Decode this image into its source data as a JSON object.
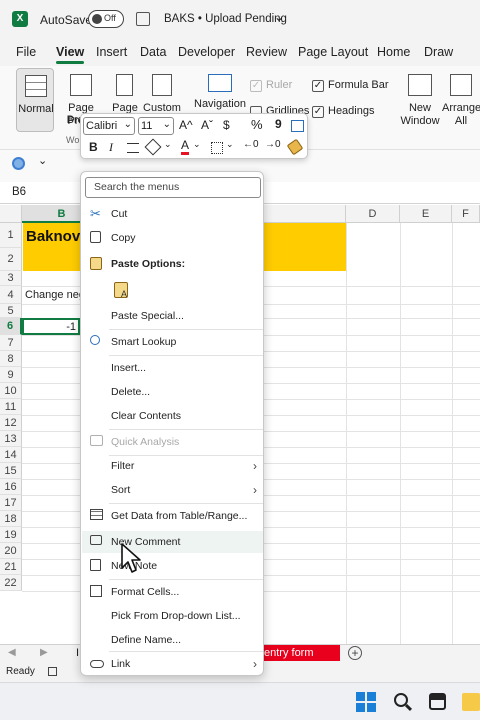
{
  "titlebar": {
    "autosave_label": "AutoSave",
    "toggle_state": "Off",
    "file_name": "BAKS • Upload Pending"
  },
  "menu": {
    "tabs": [
      "File",
      "View",
      "Insert",
      "Data",
      "Developer",
      "Review",
      "Page Layout",
      "Home",
      "Draw"
    ],
    "active": "View"
  },
  "ribbon": {
    "normal": "Normal",
    "page_break": "Page Break",
    "page_break_2": "Previ",
    "page": "Page",
    "custom": "Custom",
    "navigation": "Navigation",
    "ruler": "Ruler",
    "formula_bar": "Formula Bar",
    "gridlines": "Gridlines",
    "headings": "Headings",
    "new_window": "New Window",
    "new_window_1": "New",
    "new_window_2": "Window",
    "arrange_all_1": "Arrange",
    "arrange_all_2": "All",
    "wo_label": "Wo",
    "ruler_checked": true,
    "formula_bar_checked": true,
    "headings_checked": true
  },
  "formula": {
    "name_box": "B6"
  },
  "grid": {
    "columns": [
      "B",
      "D",
      "E",
      "F"
    ],
    "rows": [
      "1",
      "2",
      "3",
      "4",
      "5",
      "6",
      "7",
      "8",
      "9",
      "10",
      "11",
      "12",
      "13",
      "14",
      "15",
      "16",
      "17",
      "18",
      "19",
      "20",
      "21",
      "22"
    ],
    "cell_b1": "Baknov",
    "cell_b4": "Change neg",
    "cell_b6": "-1",
    "header_fill": "#ffcc00"
  },
  "mini_toolbar": {
    "font": "Calibri",
    "size": "11",
    "grow": "A^",
    "shrink": "Aˇ",
    "currency": "$",
    "percent": "%",
    "comma": "9",
    "bold": "B",
    "italic": "I",
    "font_color_letter": "A",
    "font_color": "#e81123"
  },
  "context_menu": {
    "search_placeholder": "Search the menus",
    "items": {
      "cut": "Cut",
      "copy": "Copy",
      "paste_options": "Paste Options:",
      "paste_special": "Paste Special...",
      "smart_lookup": "Smart Lookup",
      "insert": "Insert...",
      "delete": "Delete...",
      "clear_contents": "Clear Contents",
      "quick_analysis": "Quick Analysis",
      "filter": "Filter",
      "sort": "Sort",
      "get_data": "Get Data from Table/Range...",
      "new_comment": "New Comment",
      "new_note": "New Note",
      "format_cells": "Format Cells...",
      "pick_list": "Pick From Drop-down List...",
      "define_name": "Define Name...",
      "link": "Link"
    }
  },
  "sheet_tabs": {
    "visible_tab_partial": "I",
    "entry_form": "entry form",
    "entry_form_color": "#e8001c"
  },
  "status": {
    "ready": "Ready"
  },
  "colors": {
    "accent": "#107c41"
  }
}
